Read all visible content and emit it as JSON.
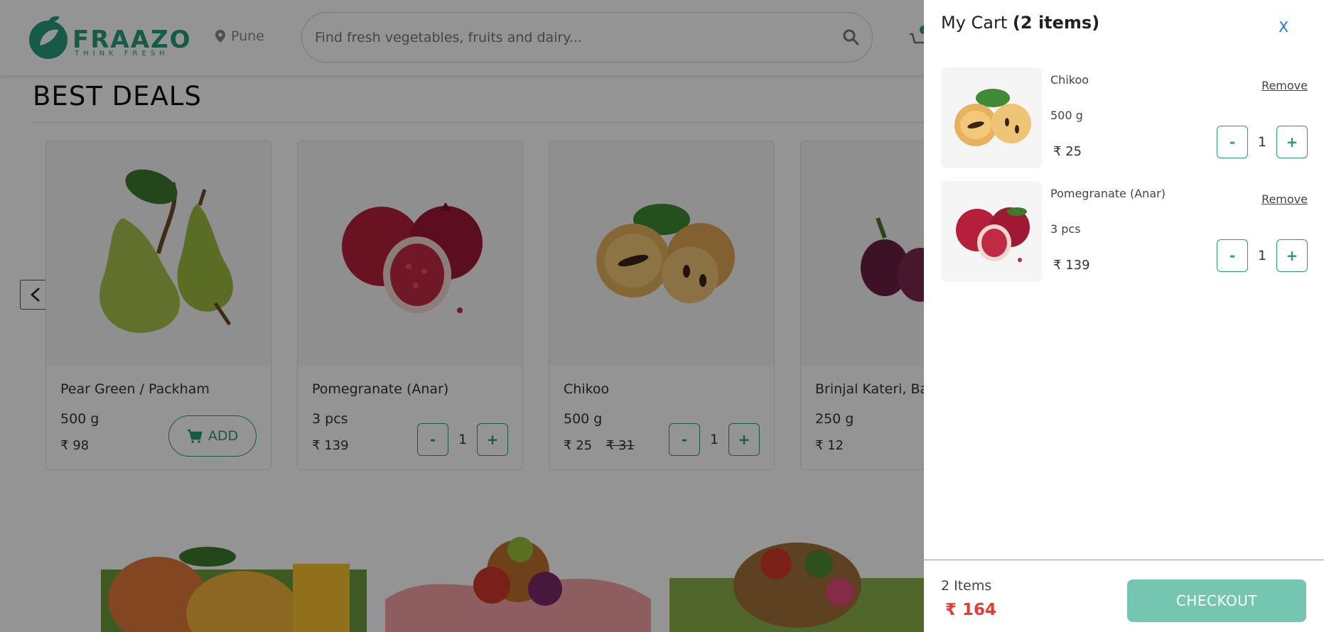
{
  "header": {
    "logo_text": "FRAAZO",
    "logo_tagline": "THINK FRESH",
    "location": "Pune",
    "search_placeholder": "Find fresh vegetables, fruits and dairy..."
  },
  "section": {
    "title": "BEST DEALS"
  },
  "currency": "₹",
  "products": [
    {
      "name": "Pear Green / Packham",
      "qty": "500 g",
      "price": "98",
      "action": "ADD"
    },
    {
      "name": "Pomegranate (Anar)",
      "qty": "3 pcs",
      "price": "139",
      "count": "1"
    },
    {
      "name": "Chikoo",
      "qty": "500 g",
      "price": "25",
      "mrp": "31",
      "count": "1"
    },
    {
      "name": "Brinjal Kateri, Ba",
      "qty": "250 g",
      "price": "12"
    }
  ],
  "cart": {
    "title": "My Cart",
    "count_label": "(2 items)",
    "close": "X",
    "items": [
      {
        "name": "Chikoo",
        "qty": "500 g",
        "price": "25",
        "count": "1",
        "remove": "Remove",
        "minus": "-",
        "plus": "+"
      },
      {
        "name": "Pomegranate (Anar)",
        "qty": "3 pcs",
        "price": "139",
        "count": "1",
        "remove": "Remove",
        "minus": "-",
        "plus": "+"
      }
    ],
    "footer": {
      "items": "2 Items",
      "total": "164",
      "checkout": "CHECKOUT"
    }
  },
  "colors": {
    "brand": "#2a9b7c",
    "checkout": "#74c6b0",
    "total": "#e53935",
    "close": "#1a73e8"
  }
}
